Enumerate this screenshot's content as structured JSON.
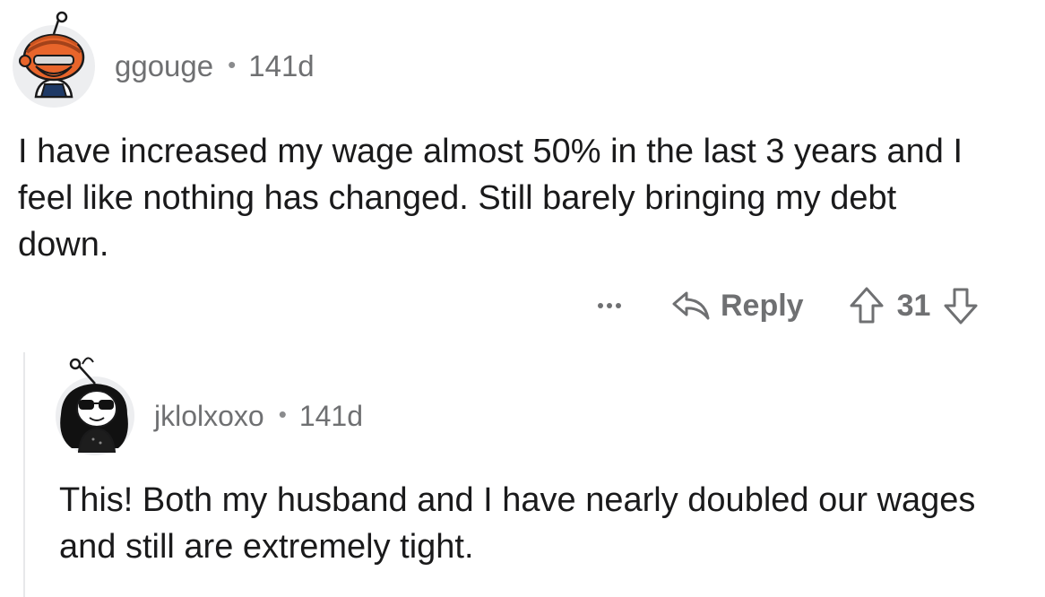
{
  "comments": [
    {
      "username": "ggouge",
      "separator": "•",
      "age": "141d",
      "body": "I have increased my wage almost 50% in the last 3 years and I feel like nothing has changed. Still barely bringing my debt down.",
      "actions": {
        "more_label": "...",
        "reply_label": "Reply",
        "score": "31"
      }
    },
    {
      "username": "jklolxoxo",
      "separator": "•",
      "age": "141d",
      "body": "This! Both my husband and I have nearly doubled our wages and still are extremely tight."
    }
  ],
  "icons": {
    "more": "more-options-icon",
    "reply": "reply-arrow-icon",
    "upvote": "upvote-arrow-icon",
    "downvote": "downvote-arrow-icon"
  },
  "colors": {
    "meta_text": "#6f7072",
    "body_text": "#1a1a1b",
    "thread_line": "#e7e8ea",
    "avatar_orange": "#e8652b"
  }
}
